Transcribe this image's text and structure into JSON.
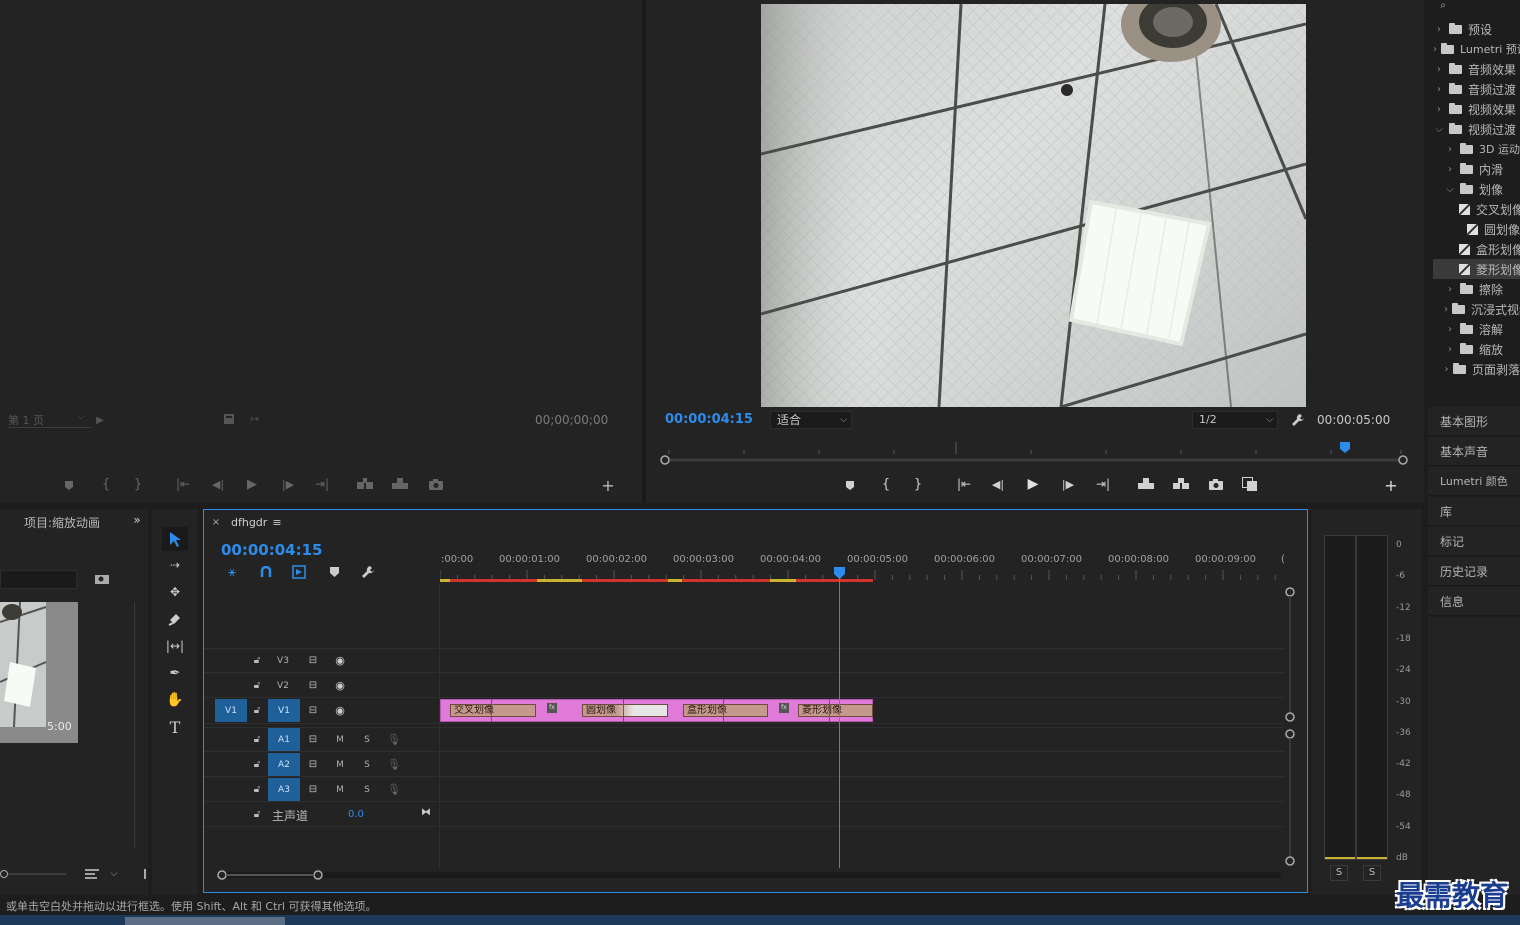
{
  "source_monitor": {
    "page_select": "第 1 页",
    "timecode": "00;00;00;00"
  },
  "program_monitor": {
    "timecode": "00:00:04:15",
    "fit_select": "适合",
    "resolution_select": "1/2",
    "duration": "00:00:05:00"
  },
  "project_panel": {
    "title": "项目:缩放动画",
    "thumb_duration": "5:00"
  },
  "timeline": {
    "sequence_name": "dfhgdr",
    "timecode": "00:00:04:15",
    "ruler": [
      ":00:00",
      "00:00:01:00",
      "00:00:02:00",
      "00:00:03:00",
      "00:00:04:00",
      "00:00:05:00",
      "00:00:06:00",
      "00:00:07:00",
      "00:00:08:00",
      "00:00:09:00",
      "("
    ],
    "tracks": {
      "v3": "V3",
      "v2": "V2",
      "v1": "V1",
      "v1_target": "V1",
      "a1": "A1",
      "a2": "A2",
      "a3": "A3",
      "m": "M",
      "s": "S",
      "master": "主声道",
      "master_value": "0.0"
    },
    "clips": [
      "交叉划像",
      "圆划像",
      "盒形划像",
      "菱形划像"
    ],
    "fx_badge": "fx"
  },
  "effects_tree": [
    {
      "label": "预设",
      "depth": 0,
      "expanded": false,
      "kind": "bin"
    },
    {
      "label": "Lumetri 预设",
      "depth": 0,
      "expanded": false,
      "kind": "bin"
    },
    {
      "label": "音频效果",
      "depth": 0,
      "expanded": false,
      "kind": "folder"
    },
    {
      "label": "音频过渡",
      "depth": 0,
      "expanded": false,
      "kind": "folder"
    },
    {
      "label": "视频效果",
      "depth": 0,
      "expanded": false,
      "kind": "folder"
    },
    {
      "label": "视频过渡",
      "depth": 0,
      "expanded": true,
      "kind": "folder"
    },
    {
      "label": "3D 运动",
      "depth": 1,
      "expanded": false,
      "kind": "folder"
    },
    {
      "label": "内滑",
      "depth": 1,
      "expanded": false,
      "kind": "folder"
    },
    {
      "label": "划像",
      "depth": 1,
      "expanded": true,
      "kind": "folder"
    },
    {
      "label": "交叉划像",
      "depth": 2,
      "kind": "fx"
    },
    {
      "label": "圆划像",
      "depth": 2,
      "kind": "fx"
    },
    {
      "label": "盒形划像",
      "depth": 2,
      "kind": "fx"
    },
    {
      "label": "菱形划像",
      "depth": 2,
      "kind": "fx",
      "selected": true
    },
    {
      "label": "擦除",
      "depth": 1,
      "expanded": false,
      "kind": "folder"
    },
    {
      "label": "沉浸式视频",
      "depth": 1,
      "expanded": false,
      "kind": "folder"
    },
    {
      "label": "溶解",
      "depth": 1,
      "expanded": false,
      "kind": "folder"
    },
    {
      "label": "缩放",
      "depth": 1,
      "expanded": false,
      "kind": "folder"
    },
    {
      "label": "页面剥落",
      "depth": 1,
      "expanded": false,
      "kind": "folder"
    }
  ],
  "side_panels": [
    "基本图形",
    "基本声音",
    "Lumetri 颜色",
    "库",
    "标记",
    "历史记录",
    "信息"
  ],
  "audio_meter": {
    "scale": [
      "0",
      "-6",
      "-12",
      "-18",
      "-24",
      "-30",
      "-36",
      "-42",
      "-48",
      "-54",
      "dB"
    ],
    "solo_left": "S",
    "solo_right": "S"
  },
  "status_bar": "或单击空白处并拖动以进行框选。使用 Shift、Alt 和 Ctrl 可获得其他选项。",
  "watermark": "最需教育",
  "colors": {
    "accent_blue": "#2d8ceb",
    "clip_magenta": "#e07ad8",
    "clip_tan": "#c4988a",
    "playhead": "#2d8ceb"
  }
}
